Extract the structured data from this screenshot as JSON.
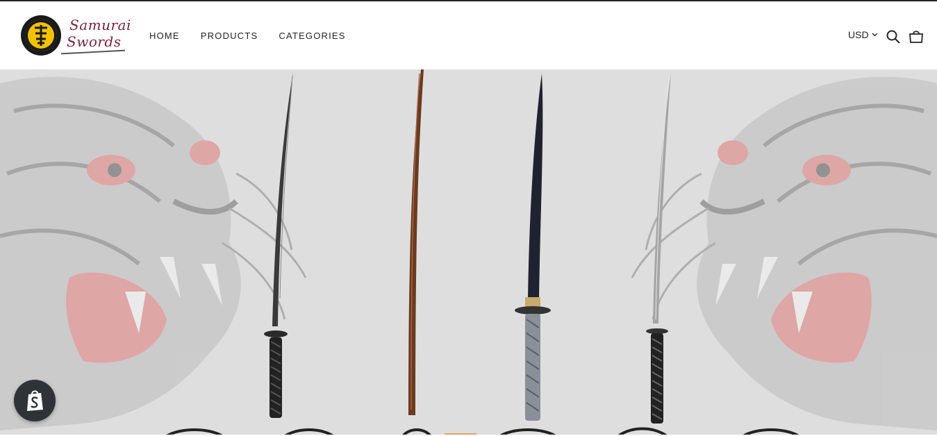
{
  "brand": {
    "logo_alt": "Samurai Swords",
    "name_line1": "Samurai",
    "name_line2": "Swords"
  },
  "nav": {
    "items": [
      {
        "label": "HOME"
      },
      {
        "label": "PRODUCTS"
      },
      {
        "label": "CATEGORIES"
      }
    ]
  },
  "header_tools": {
    "currency": "USD",
    "search_icon": "search-icon",
    "cart_icon": "bag-icon",
    "dropdown_icon": "chevron-down-icon"
  },
  "hero": {
    "image_alt": "Four samurai swords in front of tiger artwork"
  },
  "colors": {
    "brand": "#7a1f3a",
    "logo_yellow": "#f2c200",
    "hero_bg": "#dedede",
    "tiger_pink": "#e07a7a",
    "shopify_btn": "#2e3338"
  },
  "chat": {
    "icon": "shopify-icon"
  }
}
